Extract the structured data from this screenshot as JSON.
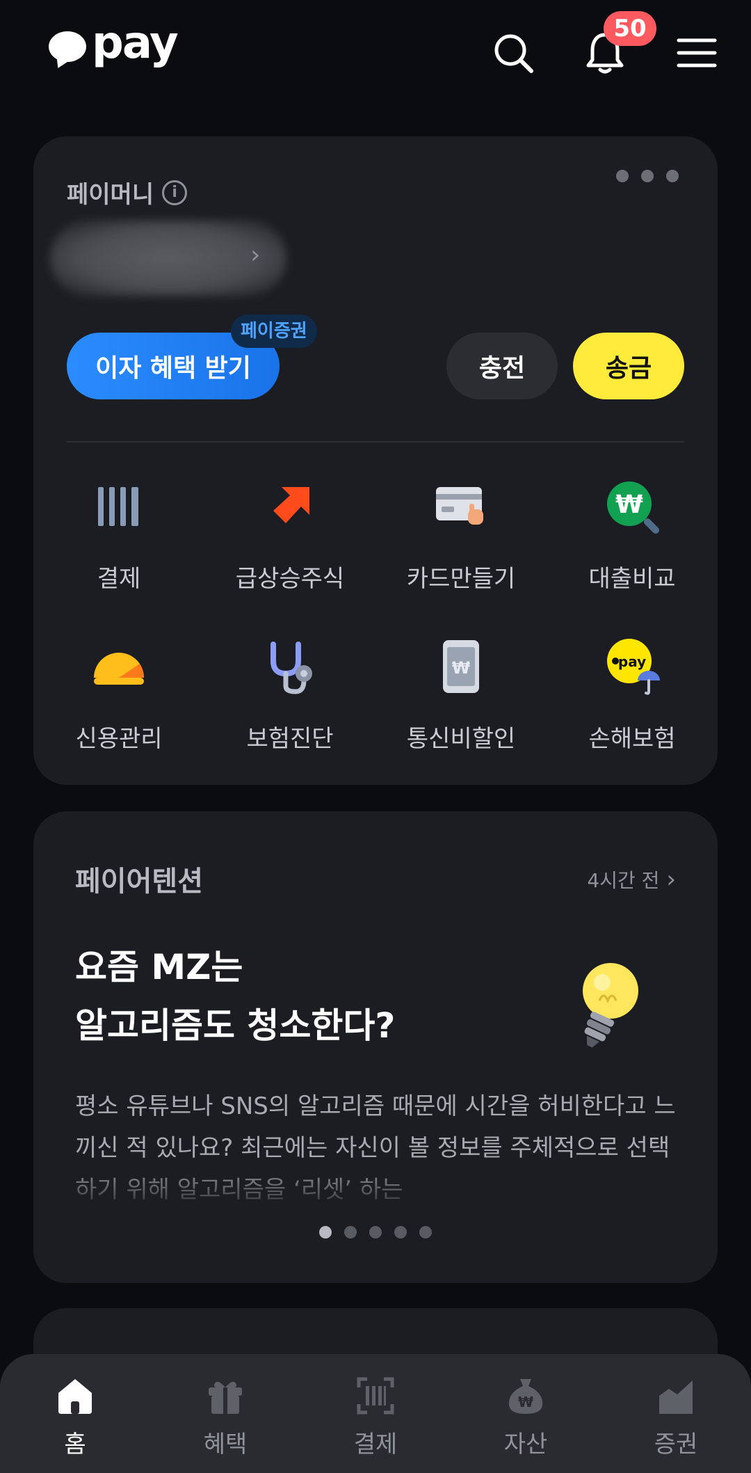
{
  "header": {
    "logo_text": "pay",
    "notification_count": "50"
  },
  "pay_money": {
    "title": "페이머니",
    "interest_button": "이자 혜택 받기",
    "interest_tag": "페이증권",
    "charge_button": "충전",
    "send_button": "송금"
  },
  "menu": {
    "items": [
      {
        "label": "결제",
        "icon": "barcode-icon"
      },
      {
        "label": "급상승주식",
        "icon": "arrow-up-icon"
      },
      {
        "label": "카드만들기",
        "icon": "card-icon"
      },
      {
        "label": "대출비교",
        "icon": "won-search-icon"
      },
      {
        "label": "신용관리",
        "icon": "credit-gauge-icon"
      },
      {
        "label": "보험진단",
        "icon": "stethoscope-icon"
      },
      {
        "label": "통신비할인",
        "icon": "phone-won-icon"
      },
      {
        "label": "손해보험",
        "icon": "pay-umbrella-icon"
      }
    ]
  },
  "attention": {
    "title": "페이어텐션",
    "time": "4시간 전",
    "headline_line1": "요즘 MZ는",
    "headline_line2": "알고리즘도 청소한다?",
    "description": "평소 유튜브나 SNS의 알고리즘 때문에 시간을 허비한다고 느끼신 적 있나요? 최근에는 자신이 볼 정보를 주체적으로 선택하기 위해 알고리즘을 ‘리셋’ 하는",
    "page_count": 5,
    "active_page": 1
  },
  "bottom_nav": {
    "items": [
      {
        "label": "홈",
        "icon": "home-icon",
        "active": true
      },
      {
        "label": "혜택",
        "icon": "gift-icon",
        "active": false
      },
      {
        "label": "결제",
        "icon": "scan-pay-icon",
        "active": false
      },
      {
        "label": "자산",
        "icon": "money-bag-icon",
        "active": false
      },
      {
        "label": "증권",
        "icon": "chart-icon",
        "active": false
      }
    ]
  },
  "colors": {
    "background": "#0b0c10",
    "card": "#1c1d22",
    "accent_blue": "#1a73e8",
    "accent_yellow": "#ffeb3b",
    "badge_red": "#ff5a5f"
  }
}
